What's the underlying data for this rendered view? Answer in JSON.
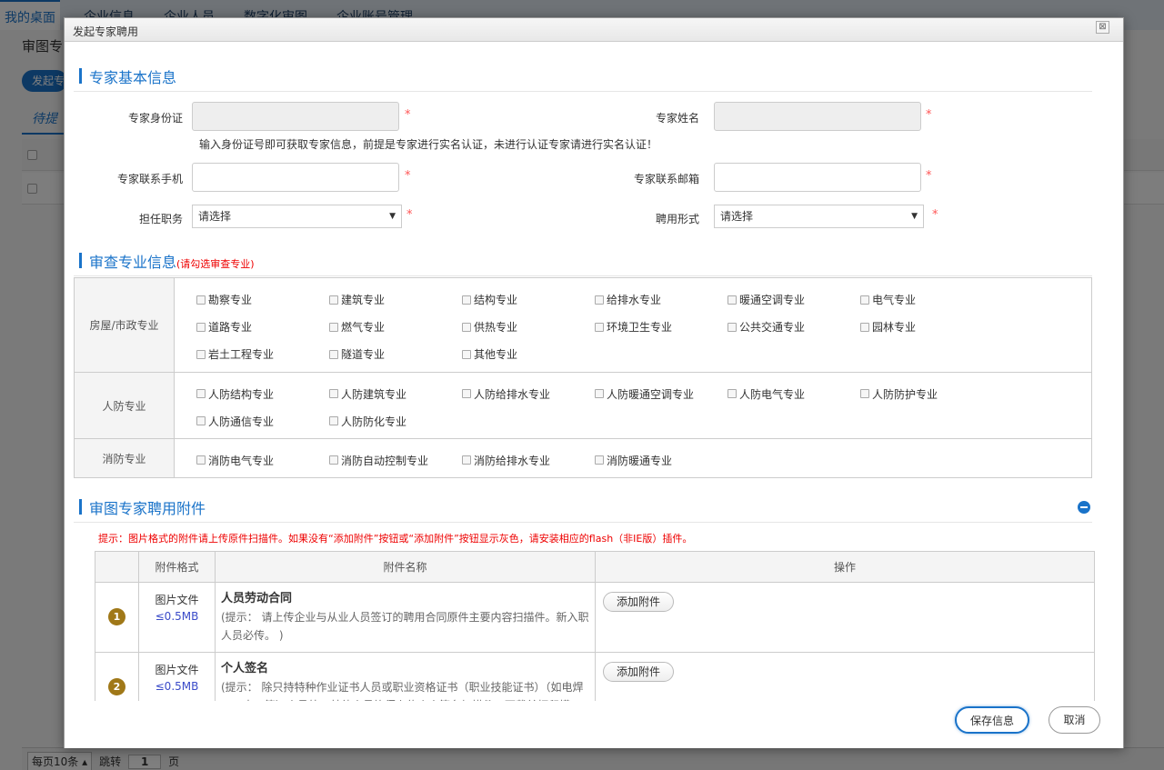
{
  "background": {
    "nav_tabs": [
      "我的桌面",
      "企业信息",
      "企业人员",
      "数字化审图",
      "企业账号管理"
    ],
    "title": "审图专",
    "button": "发起专",
    "tab": "待提",
    "pager": {
      "per_page": "每页10条",
      "jump": "跳转",
      "page": "1",
      "page_unit": "页"
    }
  },
  "modal": {
    "title": "发起专家聘用",
    "close": "⊠",
    "basic": {
      "title": "专家基本信息",
      "id_label": "专家身份证",
      "name_label": "专家姓名",
      "id_tip": "输入身份证号即可获取专家信息，前提是专家进行实名认证，未进行认证专家请进行实名认证！",
      "phone_label": "专家联系手机",
      "email_label": "专家联系邮箱",
      "position_label": "担任职务",
      "position_value": "请选择",
      "employ_label": "聘用形式",
      "employ_value": "请选择",
      "required": "*"
    },
    "spec": {
      "title": "审查专业信息",
      "hint": "(请勾选审查专业)",
      "groups": [
        {
          "name": "房屋/市政专业",
          "items": [
            "勘察专业",
            "建筑专业",
            "结构专业",
            "给排水专业",
            "暖通空调专业",
            "电气专业",
            "道路专业",
            "燃气专业",
            "供热专业",
            "环境卫生专业",
            "公共交通专业",
            "园林专业",
            "岩土工程专业",
            "隧道专业",
            "其他专业"
          ]
        },
        {
          "name": "人防专业",
          "items": [
            "人防结构专业",
            "人防建筑专业",
            "人防给排水专业",
            "人防暖通空调专业",
            "人防电气专业",
            "人防防护专业",
            "人防通信专业",
            "人防防化专业"
          ]
        },
        {
          "name": "消防专业",
          "items": [
            "消防电气专业",
            "消防自动控制专业",
            "消防给排水专业",
            "消防暖通专业"
          ]
        }
      ]
    },
    "attach": {
      "title": "审图专家聘用附件",
      "tip": "提示：图片格式的附件请上传原件扫描件。如果没有“添加附件”按钮或“添加附件”按钮显示灰色，请安装相应的flash（非IE版）插件。",
      "headers": [
        "",
        "附件格式",
        "附件名称",
        "操作"
      ],
      "rows": [
        {
          "idx": "1",
          "fmt": "图片文件",
          "size": "≤0.5MB",
          "name": "人员劳动合同",
          "desc": "(提示： 请上传企业与从业人员签订的聘用合同原件主要内容扫描件。新入职人员必传。 )",
          "action": "添加附件"
        },
        {
          "idx": "2",
          "fmt": "图片文件",
          "size": "≤0.5MB",
          "name": "个人签名",
          "desc": "(提示： 除只持特种作业证书人员或职业资格证书（职业技能证书）（如电焊工、木工等）人员外，其他人员均须上传个人签名扫描件，下载并打印模",
          "action": "添加附件"
        }
      ]
    },
    "footer": {
      "save": "保存信息",
      "cancel": "取消"
    }
  }
}
